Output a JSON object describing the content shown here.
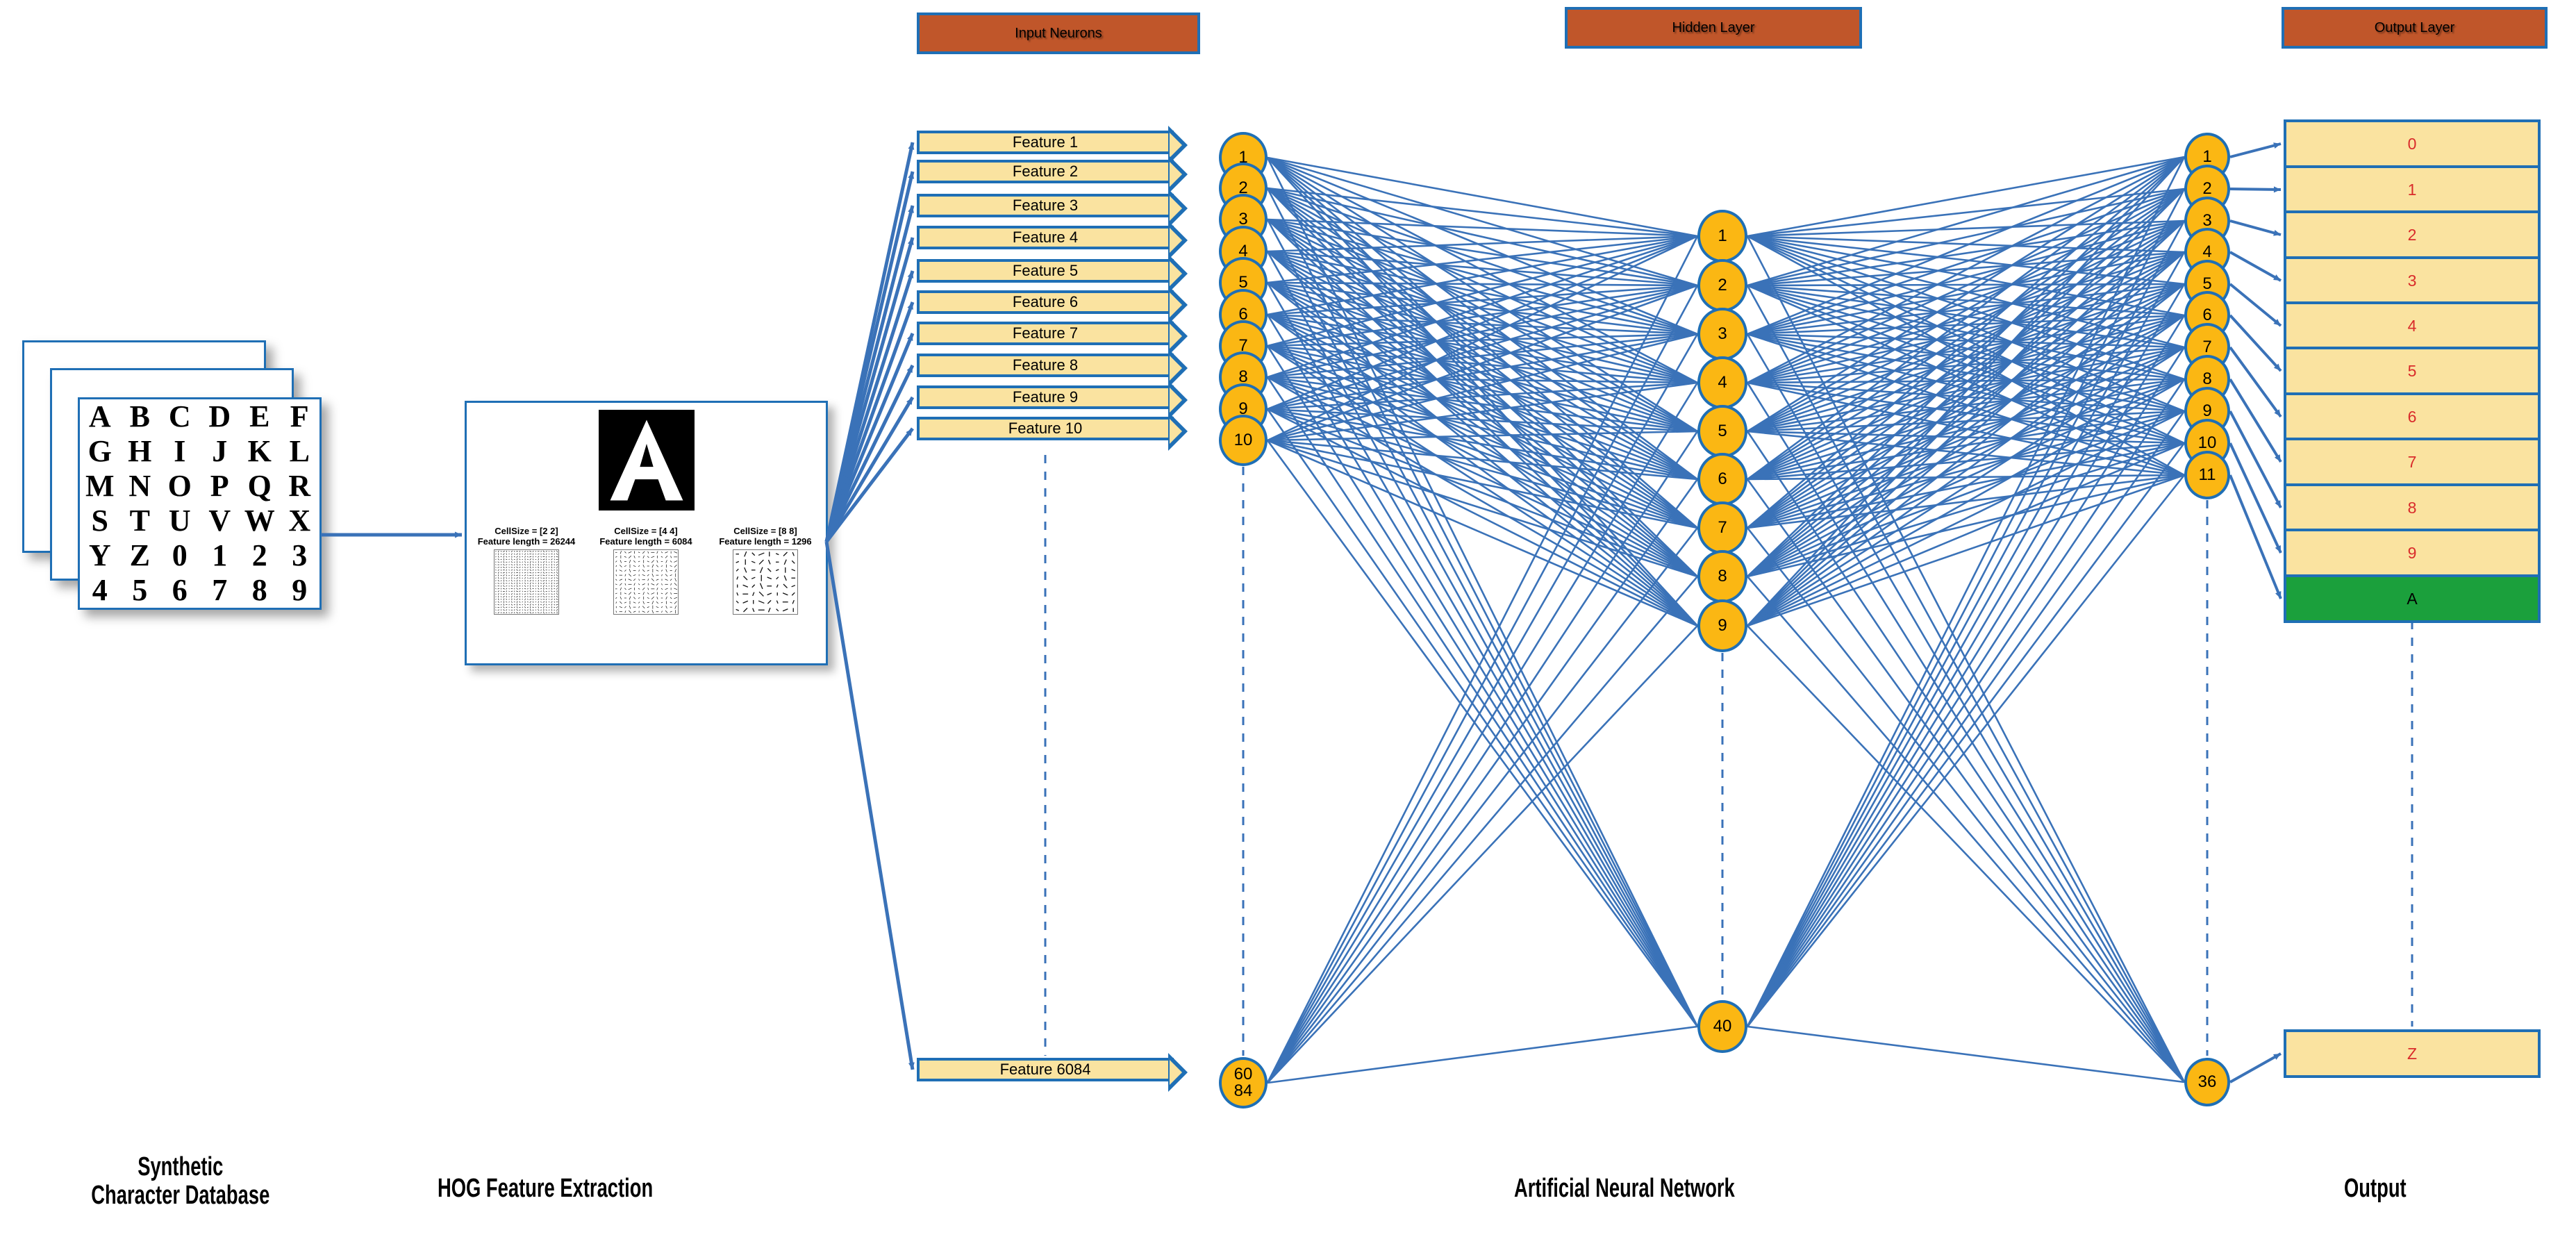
{
  "database": {
    "name": "Synthetic Character Database",
    "cards": 3,
    "characters": [
      "A",
      "B",
      "C",
      "D",
      "E",
      "F",
      "G",
      "H",
      "I",
      "J",
      "K",
      "L",
      "M",
      "N",
      "O",
      "P",
      "Q",
      "R",
      "S",
      "T",
      "U",
      "V",
      "W",
      "X",
      "Y",
      "Z",
      "0",
      "1",
      "2",
      "3",
      "4",
      "5",
      "6",
      "7",
      "8",
      "9"
    ]
  },
  "hog_panel": {
    "sample_letter": "A",
    "columns": [
      {
        "cell_size": "CellSize = [2 2]",
        "feature_length": "Feature length = 26244"
      },
      {
        "cell_size": "CellSize = [4 4]",
        "feature_length": "Feature length = 6084"
      },
      {
        "cell_size": "CellSize = [8 8]",
        "feature_length": "Feature length = 1296"
      }
    ]
  },
  "headers": {
    "input": "Input Neurons",
    "hidden": "Hidden Layer",
    "output": "Output Layer"
  },
  "features": [
    "Feature 1",
    "Feature 2",
    "Feature 3",
    "Feature 4",
    "Feature 5",
    "Feature 6",
    "Feature 7",
    "Feature 8",
    "Feature 9",
    "Feature 10",
    "Feature 6084"
  ],
  "input_neurons": [
    "1",
    "2",
    "3",
    "4",
    "5",
    "6",
    "7",
    "8",
    "9",
    "10",
    "60\n84"
  ],
  "input_neuron_last_lines": [
    "60",
    "84"
  ],
  "hidden_neurons": [
    "1",
    "2",
    "3",
    "4",
    "5",
    "6",
    "7",
    "8",
    "9",
    "40"
  ],
  "output_neurons": [
    "1",
    "2",
    "3",
    "4",
    "5",
    "6",
    "7",
    "8",
    "9",
    "10",
    "11",
    "36"
  ],
  "output_boxes": [
    {
      "label": "0",
      "highlighted": false
    },
    {
      "label": "1",
      "highlighted": false
    },
    {
      "label": "2",
      "highlighted": false
    },
    {
      "label": "3",
      "highlighted": false
    },
    {
      "label": "4",
      "highlighted": false
    },
    {
      "label": "5",
      "highlighted": false
    },
    {
      "label": "6",
      "highlighted": false
    },
    {
      "label": "7",
      "highlighted": false
    },
    {
      "label": "8",
      "highlighted": false
    },
    {
      "label": "9",
      "highlighted": false
    },
    {
      "label": "A",
      "highlighted": true
    },
    {
      "label": "Z",
      "highlighted": false
    }
  ],
  "pipeline_caption": {
    "step1_line1": "Synthetic",
    "step1_line2": "Character Database",
    "step2": "HOG Feature Extraction",
    "step3": "Artificial Neural Network",
    "step4": "Output"
  },
  "colors": {
    "header_fill": "#C0562A",
    "border_blue": "#1F6FB5",
    "neuron_fill": "#FBB713",
    "box_fill": "#FAE3A0",
    "highlight_green": "#1BA03C",
    "output_text_red": "#D92B2B",
    "connection_blue": "#3A72B8"
  }
}
